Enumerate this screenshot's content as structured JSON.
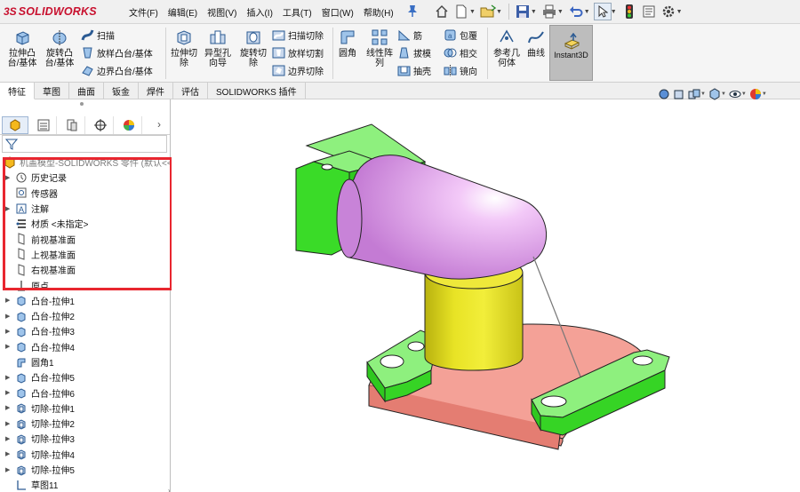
{
  "app": {
    "logo_prefix": "3S",
    "logo_name": "SOLIDWORKS",
    "menus": [
      "文件(F)",
      "编辑(E)",
      "视图(V)",
      "插入(I)",
      "工具(T)",
      "窗口(W)",
      "帮助(H)"
    ]
  },
  "quick_access": [
    "home-icon",
    "new-document-icon",
    "open-icon",
    "save-icon",
    "print-icon",
    "undo-icon",
    "select-arrow-icon",
    "traffic-light-icon",
    "document-properties-icon",
    "options-gear-icon"
  ],
  "command_manager": {
    "extrude_boss": "拉伸凸\n台/基体",
    "revolve_boss": "旋转凸\n台/基体",
    "sweep": "扫描",
    "loft_boss": "放样凸台/基体",
    "boundary_boss": "边界凸台/基体",
    "extrude_cut": "拉伸切\n除",
    "hole_wizard": "异型孔\n向导",
    "revolve_cut": "旋转切\n除",
    "sweep_cut": "扫描切除",
    "loft_cut": "放样切割",
    "boundary_cut": "边界切除",
    "fillet": "圆角",
    "linear_pattern": "线性阵\n列",
    "rib": "筋",
    "draft": "拔模",
    "shell": "抽壳",
    "wrap": "包覆",
    "intersect": "相交",
    "mirror": "镜向",
    "reference_geometry": "参考几\n何体",
    "curves": "曲线",
    "instant3d": "Instant3D"
  },
  "tabs": [
    "特征",
    "草图",
    "曲面",
    "钣金",
    "焊件",
    "评估",
    "SOLIDWORKS 插件"
  ],
  "active_tab": "特征",
  "feature_tree": {
    "root": "机盖模型-SOLIDWORKS 零件 (默认<<默认>_显示状态 1>)",
    "items": [
      {
        "label": "历史记录",
        "icon": "history-icon",
        "expand": true
      },
      {
        "label": "传感器",
        "icon": "sensor-icon",
        "expand": false
      },
      {
        "label": "注解",
        "icon": "annotation-icon",
        "expand": true
      },
      {
        "label": "材质 <未指定>",
        "icon": "material-icon",
        "expand": false
      },
      {
        "label": "前视基准面",
        "icon": "plane-icon",
        "expand": false
      },
      {
        "label": "上视基准面",
        "icon": "plane-icon",
        "expand": false
      },
      {
        "label": "右视基准面",
        "icon": "plane-icon",
        "expand": false
      },
      {
        "label": "原点",
        "icon": "origin-icon",
        "expand": false
      },
      {
        "label": "凸台-拉伸1",
        "icon": "boss-extrude-icon",
        "expand": true
      },
      {
        "label": "凸台-拉伸2",
        "icon": "boss-extrude-icon",
        "expand": true
      },
      {
        "label": "凸台-拉伸3",
        "icon": "boss-extrude-icon",
        "expand": true
      },
      {
        "label": "凸台-拉伸4",
        "icon": "boss-extrude-icon",
        "expand": true
      },
      {
        "label": "圆角1",
        "icon": "fillet-icon",
        "expand": false
      },
      {
        "label": "凸台-拉伸5",
        "icon": "boss-extrude-icon",
        "expand": true
      },
      {
        "label": "凸台-拉伸6",
        "icon": "boss-extrude-icon",
        "expand": true
      },
      {
        "label": "切除-拉伸1",
        "icon": "cut-extrude-icon",
        "expand": true
      },
      {
        "label": "切除-拉伸2",
        "icon": "cut-extrude-icon",
        "expand": true
      },
      {
        "label": "切除-拉伸3",
        "icon": "cut-extrude-icon",
        "expand": true
      },
      {
        "label": "切除-拉伸4",
        "icon": "cut-extrude-icon",
        "expand": true
      },
      {
        "label": "切除-拉伸5",
        "icon": "cut-extrude-icon",
        "expand": true
      },
      {
        "label": "草图11",
        "icon": "sketch-icon",
        "expand": false
      }
    ]
  },
  "colors": {
    "accent_red": "#e8262f",
    "green_body": "#39e22a",
    "pink_body": "#e6a8f2",
    "yellow_body": "#e3de22",
    "salmon_body": "#f2887a"
  }
}
